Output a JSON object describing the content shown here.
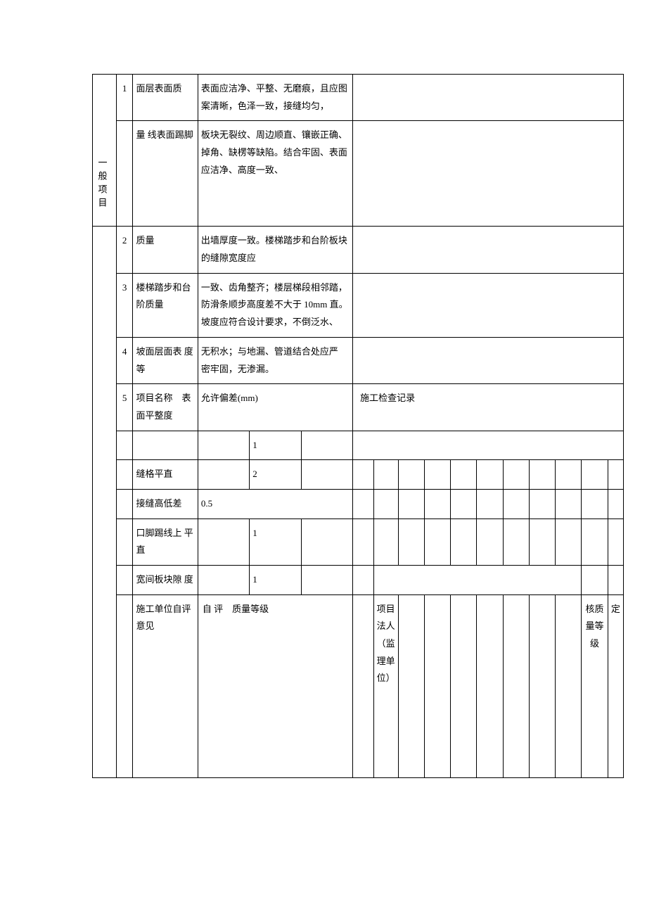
{
  "section_label": "一般项目",
  "rows": [
    {
      "num": "1",
      "name": "面层表面质",
      "desc": "表面应洁净、平整、无磨痕，且应图案清晰，色泽一致，接缝均匀，"
    },
    {
      "num": "",
      "name": "量 线表面踢脚",
      "desc": "板块无裂纹、周边顺直、镶嵌正确、掉角、缺楞等缺陷。结合牢固、表面应洁净、高度一致、"
    },
    {
      "num": "2",
      "name": "质量",
      "desc": " 出墙厚度一致。楼梯踏步和台阶板块的缝隙宽度应"
    },
    {
      "num": "3",
      "name": "楼梯踏步和台阶质量",
      "desc": " 一致、齿角整齐；楼层梯段相邻踏，防滑条顺步高度差不大于 10mm 直。坡度应符合设计要求，不倒泛水、"
    },
    {
      "num": "4",
      "name": "坡面层面表 度等",
      "desc": " 无积水；与地漏、管道结合处应严 密牢固，无渗漏。"
    }
  ],
  "row5": {
    "num": "5",
    "name": "项目名称　表面平整度",
    "desc": "允许偏差(mm)",
    "right": "施工检查记录"
  },
  "deviation_rows": [
    {
      "name": "",
      "c1": "",
      "c2": "1",
      "c3": ""
    },
    {
      "name": "缝格平直",
      "c1": "",
      "c2": "2",
      "c3": ""
    },
    {
      "name": "接缝高低差",
      "c1": "0.5",
      "c2": "",
      "c3": "",
      "full": true
    },
    {
      "name": "口脚踢线上 平直",
      "c1": "",
      "c2": "1",
      "c3": ""
    },
    {
      "name": "宽间板块隙 度",
      "c1": "",
      "c2": "1",
      "c3": ""
    }
  ],
  "bottom": {
    "name": "施工单位自评意见",
    "label": "自 评　质量等级",
    "mid": "项目法人（监理单位）",
    "right": "核定质量等级"
  }
}
